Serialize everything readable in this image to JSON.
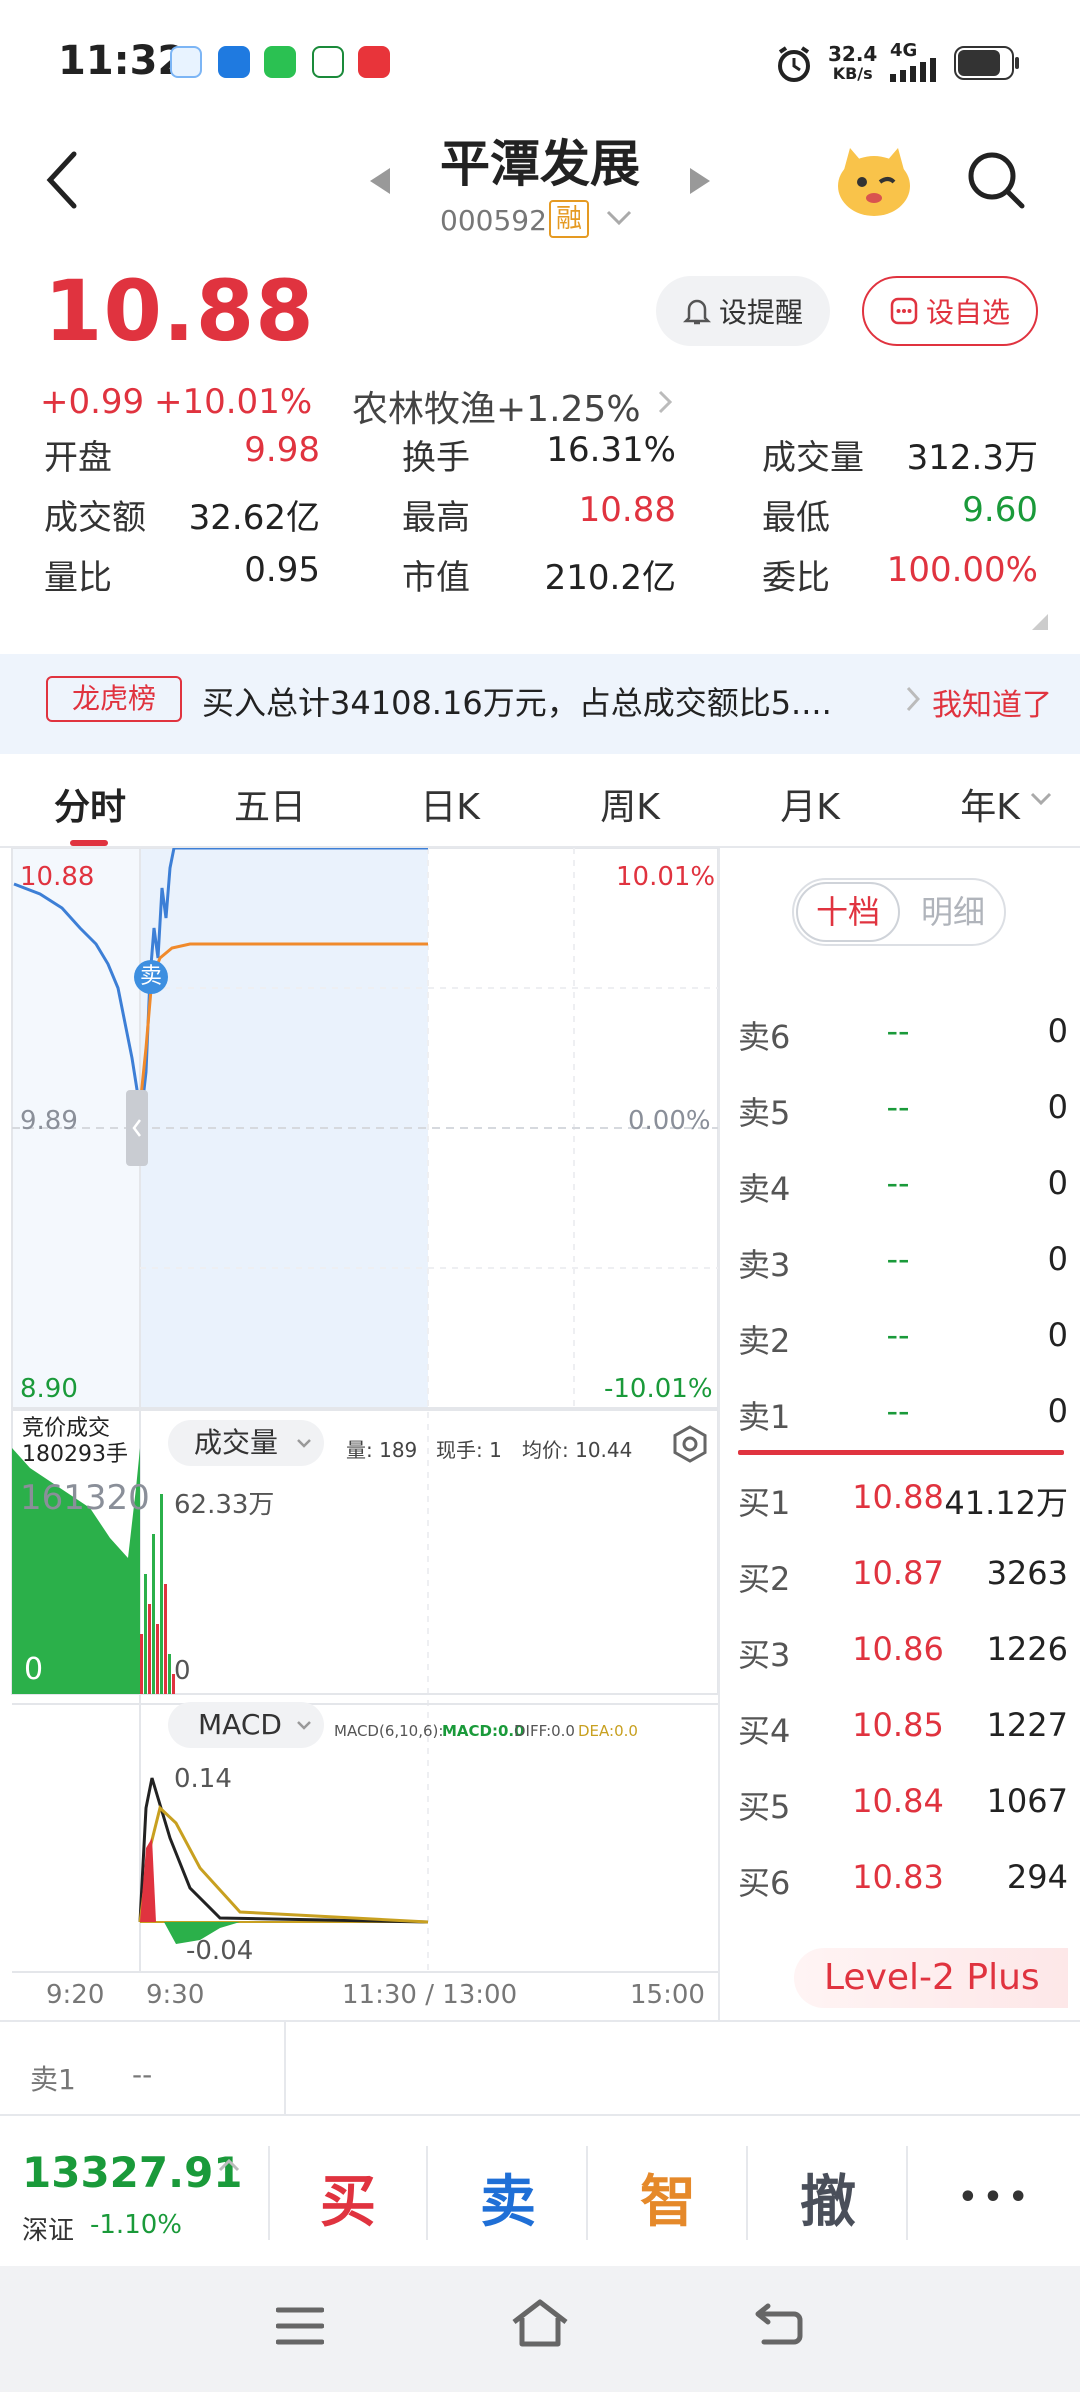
{
  "status_bar": {
    "time": "11:32",
    "net_speed": "32.4",
    "net_unit": "KB/s",
    "net_type": "4G"
  },
  "header": {
    "stock_name": "平潭发展",
    "stock_code": "000592",
    "margin_badge": "融"
  },
  "quote": {
    "price": "10.88",
    "change": "+0.99",
    "change_pct": "+10.01%",
    "sector": "农林牧渔",
    "sector_change": "+1.25%",
    "alert_btn": "设提醒",
    "watch_btn": "设自选"
  },
  "stats": [
    {
      "label": "开盘",
      "value": "9.98",
      "color": "red"
    },
    {
      "label": "换手",
      "value": "16.31%",
      "color": "black"
    },
    {
      "label": "成交量",
      "value": "312.3万",
      "color": "black"
    },
    {
      "label": "成交额",
      "value": "32.62亿",
      "color": "black"
    },
    {
      "label": "最高",
      "value": "10.88",
      "color": "red"
    },
    {
      "label": "最低",
      "value": "9.60",
      "color": "green"
    },
    {
      "label": "量比",
      "value": "0.95",
      "color": "black"
    },
    {
      "label": "市值",
      "value": "210.2亿",
      "color": "black"
    },
    {
      "label": "委比",
      "value": "100.00%",
      "color": "red"
    }
  ],
  "notice": {
    "tag": "龙虎榜",
    "text": "买入总计34108.16万元，占总成交额比5....",
    "action": "我知道了"
  },
  "tabs": [
    "分时",
    "五日",
    "日K",
    "周K",
    "月K",
    "年K"
  ],
  "chart": {
    "price_high": "10.88",
    "price_mid": "9.89",
    "price_low": "8.90",
    "pct_high": "10.01%",
    "pct_mid": "0.00%",
    "pct_low": "-10.01%",
    "auction_label": "竞价成交",
    "auction_volume": "180293手",
    "volume_selector": "成交量",
    "vol_info_1": "量: 189",
    "vol_info_2": "现手: 1",
    "vol_info_3": "均价: 10.44",
    "vol_max_left": "161320",
    "vol_max_right": "62.33万",
    "vol_zero_left": "0",
    "vol_zero_right": "0",
    "macd_selector": "MACD",
    "macd_params": "MACD(6,10,6):",
    "macd_val": "MACD:0.0",
    "diff_val": "DIFF:0.0",
    "dea_val": "DEA:0.0",
    "macd_high": "0.14",
    "macd_low": "-0.04",
    "times": [
      "9:20",
      "9:30",
      "11:30 / 13:00",
      "15:00"
    ],
    "sell_marker": "卖"
  },
  "orderbook": {
    "tab_active": "十档",
    "tab_inactive": "明细",
    "asks": [
      {
        "label": "卖6",
        "price": "--",
        "vol": "0"
      },
      {
        "label": "卖5",
        "price": "--",
        "vol": "0"
      },
      {
        "label": "卖4",
        "price": "--",
        "vol": "0"
      },
      {
        "label": "卖3",
        "price": "--",
        "vol": "0"
      },
      {
        "label": "卖2",
        "price": "--",
        "vol": "0"
      },
      {
        "label": "卖1",
        "price": "--",
        "vol": "0"
      }
    ],
    "bids": [
      {
        "label": "买1",
        "price": "10.88",
        "vol": "41.12万"
      },
      {
        "label": "买2",
        "price": "10.87",
        "vol": "3263"
      },
      {
        "label": "买3",
        "price": "10.86",
        "vol": "1226"
      },
      {
        "label": "买4",
        "price": "10.85",
        "vol": "1227"
      },
      {
        "label": "买5",
        "price": "10.84",
        "vol": "1067"
      },
      {
        "label": "买6",
        "price": "10.83",
        "vol": "294"
      }
    ],
    "level2": "Level-2 Plus"
  },
  "footer_ticker": {
    "label": "卖1",
    "value": "--"
  },
  "index": {
    "value": "13327.91",
    "name": "深证",
    "change": "-1.10%"
  },
  "actions": {
    "buy": "买",
    "sell": "卖",
    "smart": "智",
    "cancel": "撤",
    "more": "•••"
  },
  "colors": {
    "up": "#e0333f",
    "down": "#1a9a3a",
    "accent": "#e0333f",
    "price_line": "#3d7fd6",
    "avg_line": "#f08a2c"
  }
}
